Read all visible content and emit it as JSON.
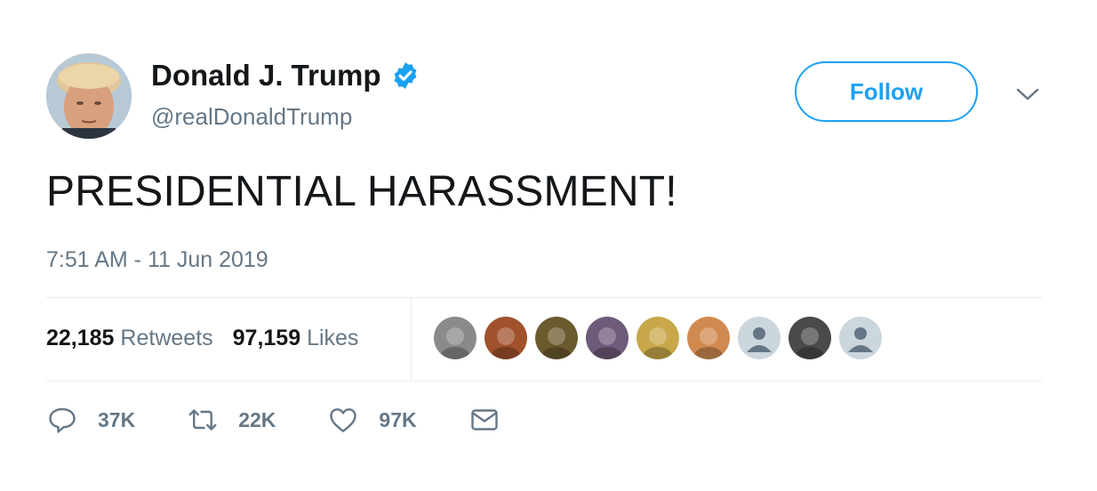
{
  "author": {
    "display_name": "Donald J. Trump",
    "handle": "@realDonaldTrump",
    "verified_icon": "verified-badge-icon",
    "avatar_icon": "profile-avatar"
  },
  "header": {
    "follow_label": "Follow",
    "menu_icon": "chevron-down-icon"
  },
  "tweet": {
    "text": "PRESIDENTIAL HARASSMENT!",
    "timestamp": "7:51 AM - 11 Jun 2019"
  },
  "stats": {
    "retweets_count": "22,185",
    "retweets_label": "Retweets",
    "likes_count": "97,159",
    "likes_label": "Likes"
  },
  "likers": [
    {
      "name": "liker-avatar-1",
      "color": "#8a8a8a"
    },
    {
      "name": "liker-avatar-2",
      "color": "#a0522d"
    },
    {
      "name": "liker-avatar-3",
      "color": "#6b5a2e"
    },
    {
      "name": "liker-avatar-4",
      "color": "#6e5a7a"
    },
    {
      "name": "liker-avatar-5",
      "color": "#c8a84a"
    },
    {
      "name": "liker-avatar-6",
      "color": "#d08a50"
    },
    {
      "name": "liker-avatar-7",
      "color": "#ccd6dd"
    },
    {
      "name": "liker-avatar-8",
      "color": "#4a4a4a"
    },
    {
      "name": "liker-avatar-9",
      "color": "#ccd6dd"
    }
  ],
  "actions": {
    "reply_count": "37K",
    "retweet_count": "22K",
    "like_count": "97K"
  },
  "colors": {
    "accent": "#1da1f2",
    "secondary_text": "#657786",
    "primary_text": "#14171a",
    "divider": "#e6ecf0"
  }
}
